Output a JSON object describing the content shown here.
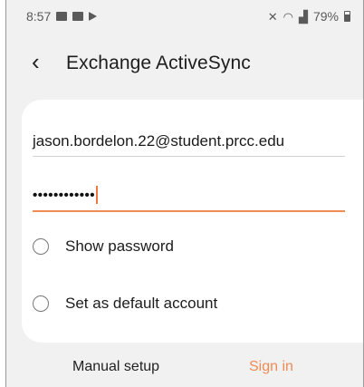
{
  "status_bar": {
    "time": "8:57",
    "battery_percent": "79%",
    "left_icons": [
      "mail-icon",
      "image-icon",
      "play-icon"
    ],
    "right_icons": [
      "mute-icon",
      "wifi-icon",
      "signal-icon",
      "battery-icon"
    ]
  },
  "header": {
    "back_icon": "back-arrow-icon",
    "title": "Exchange ActiveSync"
  },
  "form": {
    "email": "jason.bordelon.22@student.prcc.edu",
    "password_masked": "••••••••••••",
    "show_password_label": "Show password",
    "show_password_checked": false,
    "default_account_label": "Set as default account",
    "default_account_checked": false
  },
  "actions": {
    "manual_setup_label": "Manual setup",
    "sign_in_label": "Sign in"
  },
  "colors": {
    "accent": "#ef8b55",
    "background": "#f1f1f1",
    "card": "#ffffff"
  }
}
